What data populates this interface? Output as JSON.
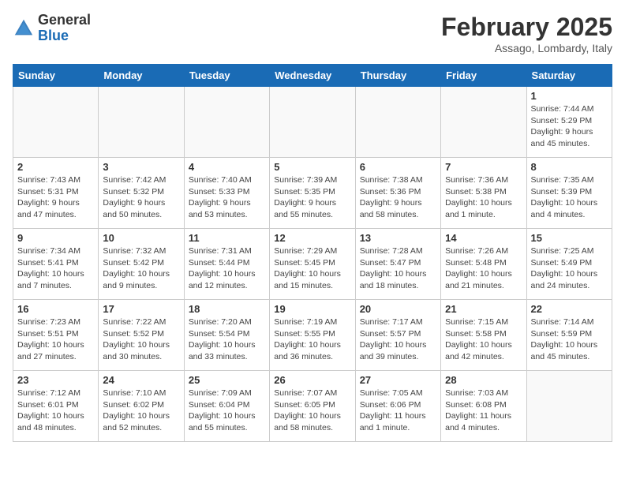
{
  "header": {
    "logo_general": "General",
    "logo_blue": "Blue",
    "title": "February 2025",
    "subtitle": "Assago, Lombardy, Italy"
  },
  "days_of_week": [
    "Sunday",
    "Monday",
    "Tuesday",
    "Wednesday",
    "Thursday",
    "Friday",
    "Saturday"
  ],
  "weeks": [
    [
      {
        "day": "",
        "info": ""
      },
      {
        "day": "",
        "info": ""
      },
      {
        "day": "",
        "info": ""
      },
      {
        "day": "",
        "info": ""
      },
      {
        "day": "",
        "info": ""
      },
      {
        "day": "",
        "info": ""
      },
      {
        "day": "1",
        "info": "Sunrise: 7:44 AM\nSunset: 5:29 PM\nDaylight: 9 hours and 45 minutes."
      }
    ],
    [
      {
        "day": "2",
        "info": "Sunrise: 7:43 AM\nSunset: 5:31 PM\nDaylight: 9 hours and 47 minutes."
      },
      {
        "day": "3",
        "info": "Sunrise: 7:42 AM\nSunset: 5:32 PM\nDaylight: 9 hours and 50 minutes."
      },
      {
        "day": "4",
        "info": "Sunrise: 7:40 AM\nSunset: 5:33 PM\nDaylight: 9 hours and 53 minutes."
      },
      {
        "day": "5",
        "info": "Sunrise: 7:39 AM\nSunset: 5:35 PM\nDaylight: 9 hours and 55 minutes."
      },
      {
        "day": "6",
        "info": "Sunrise: 7:38 AM\nSunset: 5:36 PM\nDaylight: 9 hours and 58 minutes."
      },
      {
        "day": "7",
        "info": "Sunrise: 7:36 AM\nSunset: 5:38 PM\nDaylight: 10 hours and 1 minute."
      },
      {
        "day": "8",
        "info": "Sunrise: 7:35 AM\nSunset: 5:39 PM\nDaylight: 10 hours and 4 minutes."
      }
    ],
    [
      {
        "day": "9",
        "info": "Sunrise: 7:34 AM\nSunset: 5:41 PM\nDaylight: 10 hours and 7 minutes."
      },
      {
        "day": "10",
        "info": "Sunrise: 7:32 AM\nSunset: 5:42 PM\nDaylight: 10 hours and 9 minutes."
      },
      {
        "day": "11",
        "info": "Sunrise: 7:31 AM\nSunset: 5:44 PM\nDaylight: 10 hours and 12 minutes."
      },
      {
        "day": "12",
        "info": "Sunrise: 7:29 AM\nSunset: 5:45 PM\nDaylight: 10 hours and 15 minutes."
      },
      {
        "day": "13",
        "info": "Sunrise: 7:28 AM\nSunset: 5:47 PM\nDaylight: 10 hours and 18 minutes."
      },
      {
        "day": "14",
        "info": "Sunrise: 7:26 AM\nSunset: 5:48 PM\nDaylight: 10 hours and 21 minutes."
      },
      {
        "day": "15",
        "info": "Sunrise: 7:25 AM\nSunset: 5:49 PM\nDaylight: 10 hours and 24 minutes."
      }
    ],
    [
      {
        "day": "16",
        "info": "Sunrise: 7:23 AM\nSunset: 5:51 PM\nDaylight: 10 hours and 27 minutes."
      },
      {
        "day": "17",
        "info": "Sunrise: 7:22 AM\nSunset: 5:52 PM\nDaylight: 10 hours and 30 minutes."
      },
      {
        "day": "18",
        "info": "Sunrise: 7:20 AM\nSunset: 5:54 PM\nDaylight: 10 hours and 33 minutes."
      },
      {
        "day": "19",
        "info": "Sunrise: 7:19 AM\nSunset: 5:55 PM\nDaylight: 10 hours and 36 minutes."
      },
      {
        "day": "20",
        "info": "Sunrise: 7:17 AM\nSunset: 5:57 PM\nDaylight: 10 hours and 39 minutes."
      },
      {
        "day": "21",
        "info": "Sunrise: 7:15 AM\nSunset: 5:58 PM\nDaylight: 10 hours and 42 minutes."
      },
      {
        "day": "22",
        "info": "Sunrise: 7:14 AM\nSunset: 5:59 PM\nDaylight: 10 hours and 45 minutes."
      }
    ],
    [
      {
        "day": "23",
        "info": "Sunrise: 7:12 AM\nSunset: 6:01 PM\nDaylight: 10 hours and 48 minutes."
      },
      {
        "day": "24",
        "info": "Sunrise: 7:10 AM\nSunset: 6:02 PM\nDaylight: 10 hours and 52 minutes."
      },
      {
        "day": "25",
        "info": "Sunrise: 7:09 AM\nSunset: 6:04 PM\nDaylight: 10 hours and 55 minutes."
      },
      {
        "day": "26",
        "info": "Sunrise: 7:07 AM\nSunset: 6:05 PM\nDaylight: 10 hours and 58 minutes."
      },
      {
        "day": "27",
        "info": "Sunrise: 7:05 AM\nSunset: 6:06 PM\nDaylight: 11 hours and 1 minute."
      },
      {
        "day": "28",
        "info": "Sunrise: 7:03 AM\nSunset: 6:08 PM\nDaylight: 11 hours and 4 minutes."
      },
      {
        "day": "",
        "info": ""
      }
    ]
  ]
}
